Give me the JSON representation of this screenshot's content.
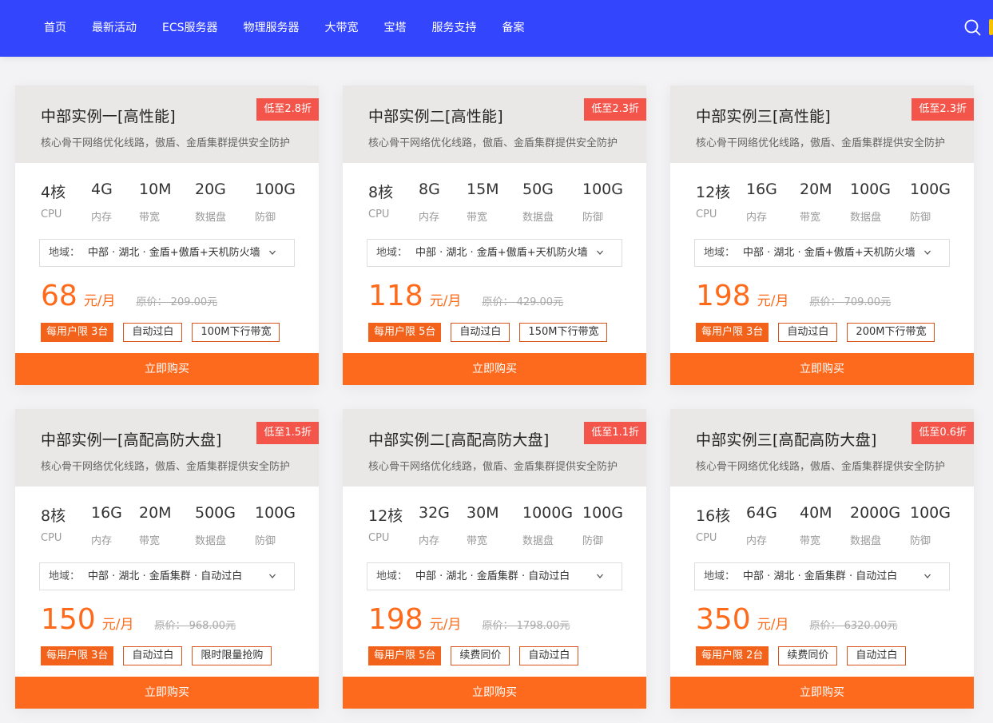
{
  "nav": {
    "items": [
      "首页",
      "最新活动",
      "ECS服务器",
      "物理服务器",
      "大带宽",
      "宝塔",
      "服务支持",
      "备案"
    ],
    "search_icon": "search-icon"
  },
  "colors": {
    "nav_bg": "#3446fd",
    "accent": "#fd6a1d",
    "discount": "#f3554a"
  },
  "spec_labels": [
    "CPU",
    "内存",
    "带宽",
    "数据盘",
    "防御"
  ],
  "region_label": "地域：",
  "buy_label": "立即购买",
  "cards": [
    {
      "title": "中部实例一[高性能]",
      "subtitle": "核心骨干网络优化线路，傲盾、金盾集群提供安全防护",
      "discount": "低至2.8折",
      "specs": [
        "4核",
        "4G",
        "10M",
        "20G",
        "100G"
      ],
      "region": "中部 · 湖北 · 金盾+傲盾+天机防火墙",
      "price": "68",
      "unit": "元/月",
      "original": "原价：  209.00元",
      "tags": [
        "每用户限 3台",
        "自动过白",
        "100M下行带宽"
      ]
    },
    {
      "title": "中部实例二[高性能]",
      "subtitle": "核心骨干网络优化线路，傲盾、金盾集群提供安全防护",
      "discount": "低至2.3折",
      "specs": [
        "8核",
        "8G",
        "15M",
        "50G",
        "100G"
      ],
      "region": "中部 · 湖北 · 金盾+傲盾+天机防火墙",
      "price": "118",
      "unit": "元/月",
      "original": "原价：  429.00元",
      "tags": [
        "每用户限 5台",
        "自动过白",
        "150M下行带宽"
      ]
    },
    {
      "title": "中部实例三[高性能]",
      "subtitle": "核心骨干网络优化线路，傲盾、金盾集群提供安全防护",
      "discount": "低至2.3折",
      "specs": [
        "12核",
        "16G",
        "20M",
        "100G",
        "100G"
      ],
      "region": "中部 · 湖北 · 金盾+傲盾+天机防火墙",
      "price": "198",
      "unit": "元/月",
      "original": "原价：  709.00元",
      "tags": [
        "每用户限 3台",
        "自动过白",
        "200M下行带宽"
      ]
    },
    {
      "title": "中部实例一[高配高防大盘]",
      "subtitle": "核心骨干网络优化线路，傲盾、金盾集群提供安全防护",
      "discount": "低至1.5折",
      "specs": [
        "8核",
        "16G",
        "20M",
        "500G",
        "100G"
      ],
      "region": "中部 · 湖北 · 金盾集群 · 自动过白",
      "price": "150",
      "unit": "元/月",
      "original": "原价：  968.00元",
      "tags": [
        "每用户限 3台",
        "自动过白",
        "限时限量抢购"
      ]
    },
    {
      "title": "中部实例二[高配高防大盘]",
      "subtitle": "核心骨干网络优化线路，傲盾、金盾集群提供安全防护",
      "discount": "低至1.1折",
      "specs": [
        "12核",
        "32G",
        "30M",
        "1000G",
        "100G"
      ],
      "region": "中部 · 湖北 · 金盾集群 · 自动过白",
      "price": "198",
      "unit": "元/月",
      "original": "原价：  1798.00元",
      "tags": [
        "每用户限 5台",
        "续费同价",
        "自动过白"
      ]
    },
    {
      "title": "中部实例三[高配高防大盘]",
      "subtitle": "核心骨干网络优化线路，傲盾、金盾集群提供安全防护",
      "discount": "低至0.6折",
      "specs": [
        "16核",
        "64G",
        "40M",
        "2000G",
        "100G"
      ],
      "region": "中部 · 湖北 · 金盾集群 · 自动过白",
      "price": "350",
      "unit": "元/月",
      "original": "原价：  6320.00元",
      "tags": [
        "每用户限 2台",
        "续费同价",
        "自动过白"
      ]
    }
  ]
}
